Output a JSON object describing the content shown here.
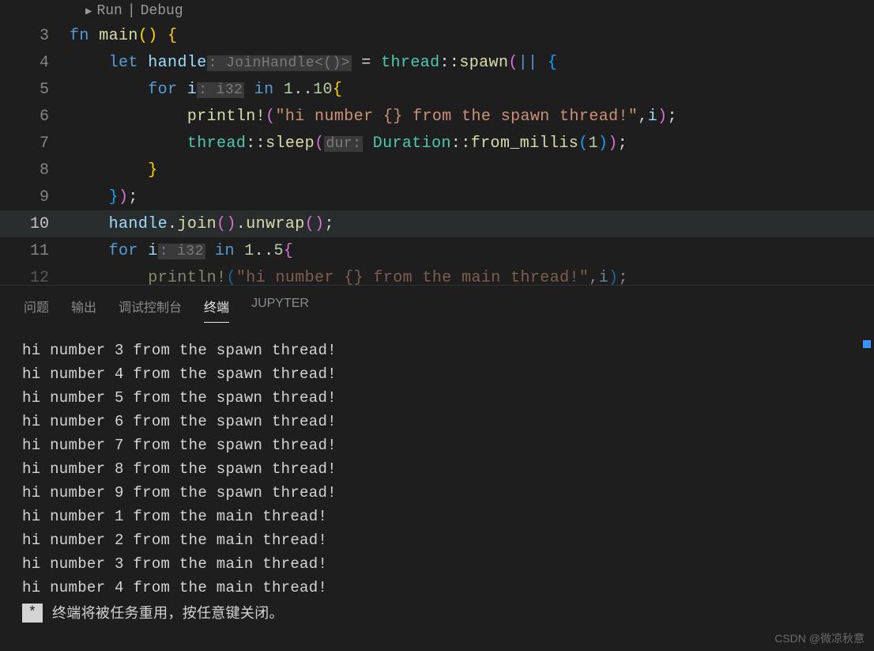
{
  "codelens": {
    "run": "Run",
    "debug": "Debug"
  },
  "line_numbers": [
    "3",
    "4",
    "5",
    "6",
    "7",
    "8",
    "9",
    "10",
    "11",
    "12"
  ],
  "highlighted_line": "10",
  "code": {
    "l3": {
      "kw_fn": "fn",
      "name": "main",
      "par_open": "(",
      "par_close": ")",
      "brace": "{"
    },
    "l4": {
      "kw_let": "let",
      "var": "handle",
      "hint": ": JoinHandle<()>",
      "eq": " = ",
      "mod": "thread",
      "sep": "::",
      "fn": "spawn",
      "po": "(",
      "bars": "||",
      "brace": " {"
    },
    "l5": {
      "kw_for": "for",
      "var": "i",
      "hint": ": i32",
      "kw_in": " in ",
      "n1": "1",
      "dots": "..",
      "n2": "10",
      "brace": "{"
    },
    "l6": {
      "mac": "println!",
      "po": "(",
      "str": "\"hi number {} from the spawn thread!\"",
      "comma": ",",
      "arg": "i",
      "pc": ")",
      "semi": ";"
    },
    "l7": {
      "mod": "thread",
      "sep": "::",
      "fn": "sleep",
      "po": "(",
      "hint": "dur:",
      "ty": " Duration",
      "sep2": "::",
      "fn2": "from_millis",
      "po2": "(",
      "n": "1",
      "pc2": ")",
      "pc": ")",
      "semi": ";"
    },
    "l8": {
      "brace": "}"
    },
    "l9": {
      "brace": "}",
      "pc": ")",
      "semi": ";"
    },
    "l10": {
      "obj": "handle",
      "dot1": ".",
      "m1": "join",
      "p1o": "(",
      "p1c": ")",
      "dot2": ".",
      "m2": "unwrap",
      "p2o": "(",
      "p2c": ")",
      "semi": ";"
    },
    "l11": {
      "kw_for": "for",
      "var": "i",
      "hint": ": i32",
      "kw_in": " in ",
      "n1": "1",
      "dots": "..",
      "n2": "5",
      "brace": "{"
    },
    "l12": {
      "mac": "println!",
      "po": "(",
      "str": "\"hi number {} from the main thread!\"",
      "comma": ",",
      "arg": "i",
      "pc": ")",
      "semi": ";"
    }
  },
  "panel": {
    "tabs": {
      "problems": "问题",
      "output": "输出",
      "debug_console": "调试控制台",
      "terminal": "终端",
      "jupyter": "JUPYTER"
    },
    "active_tab": "terminal"
  },
  "terminal_output": [
    "hi number 3 from the spawn thread!",
    "hi number 4 from the spawn thread!",
    "hi number 5 from the spawn thread!",
    "hi number 6 from the spawn thread!",
    "hi number 7 from the spawn thread!",
    "hi number 8 from the spawn thread!",
    "hi number 9 from the spawn thread!",
    "hi number 1 from the main thread!",
    "hi number 2 from the main thread!",
    "hi number 3 from the main thread!",
    "hi number 4 from the main thread!"
  ],
  "terminal_footer": "终端将被任务重用，按任意键关闭。",
  "watermark": "CSDN @微凉秋意"
}
